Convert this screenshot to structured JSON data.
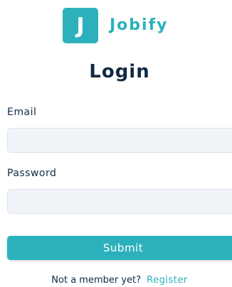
{
  "logo": {
    "mark": "J",
    "name": "Jobify"
  },
  "form": {
    "title": "Login",
    "email_label": "Email",
    "email_value": "",
    "password_label": "Password",
    "password_value": "",
    "submit_label": "Submit"
  },
  "footer": {
    "prompt": "Not a member yet?",
    "register_label": "Register"
  },
  "colors": {
    "primary": "#2cb1bc",
    "input_background": "#f0f4f8",
    "text": "#102a43"
  }
}
